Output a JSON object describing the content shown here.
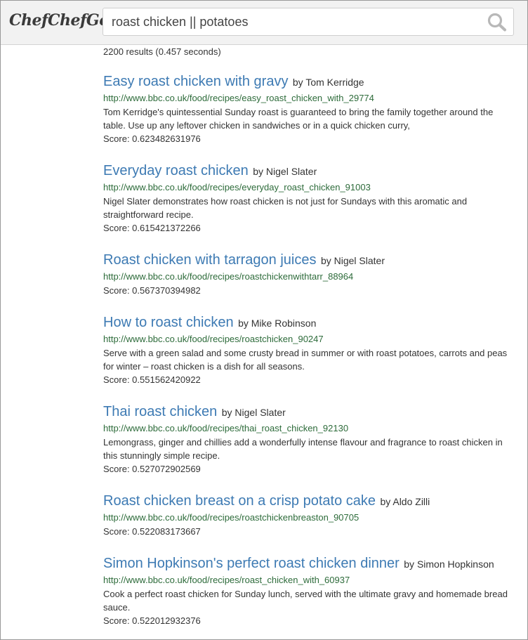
{
  "header": {
    "logo_text": "ChefChefGo",
    "search_value": "roast chicken || potatoes",
    "search_icon": "magnifier-icon"
  },
  "results_count": "2200 results (0.457 seconds)",
  "results": [
    {
      "title": "Easy roast chicken with gravy",
      "author": "by Tom Kerridge",
      "url": "http://www.bbc.co.uk/food/recipes/easy_roast_chicken_with_29774",
      "description": "Tom Kerridge's quintessential Sunday roast is guaranteed to bring the family together around the table. Use up any leftover chicken in sandwiches or in a quick chicken curry,",
      "score": "Score: 0.623482631976"
    },
    {
      "title": "Everyday roast chicken",
      "author": "by Nigel Slater",
      "url": "http://www.bbc.co.uk/food/recipes/everyday_roast_chicken_91003",
      "description": "Nigel Slater demonstrates how roast chicken is not just for Sundays with this aromatic and straightforward recipe.",
      "score": "Score: 0.615421372266"
    },
    {
      "title": "Roast chicken with tarragon juices",
      "author": "by Nigel Slater",
      "url": "http://www.bbc.co.uk/food/recipes/roastchickenwithtarr_88964",
      "description": "",
      "score": "Score: 0.567370394982"
    },
    {
      "title": "How to roast chicken",
      "author": "by Mike Robinson",
      "url": "http://www.bbc.co.uk/food/recipes/roastchicken_90247",
      "description": "Serve with a green salad and some crusty bread in summer or with roast potatoes, carrots and peas for winter – roast chicken is a dish for all seasons.",
      "score": "Score: 0.551562420922"
    },
    {
      "title": "Thai roast chicken",
      "author": "by Nigel Slater",
      "url": "http://www.bbc.co.uk/food/recipes/thai_roast_chicken_92130",
      "description": "Lemongrass, ginger and chillies add a wonderfully intense flavour and fragrance to roast chicken in this stunningly simple recipe.",
      "score": "Score: 0.527072902569"
    },
    {
      "title": "Roast chicken breast on a crisp potato cake",
      "author": "by Aldo Zilli",
      "url": "http://www.bbc.co.uk/food/recipes/roastchickenbreaston_90705",
      "description": "",
      "score": "Score: 0.522083173667"
    },
    {
      "title": "Simon Hopkinson's perfect roast chicken dinner",
      "author": "by Simon Hopkinson",
      "url": "http://www.bbc.co.uk/food/recipes/roast_chicken_with_60937",
      "description": "Cook a perfect roast chicken for Sunday lunch, served with the ultimate gravy and homemade bread sauce.",
      "score": "Score: 0.522012932376"
    }
  ]
}
